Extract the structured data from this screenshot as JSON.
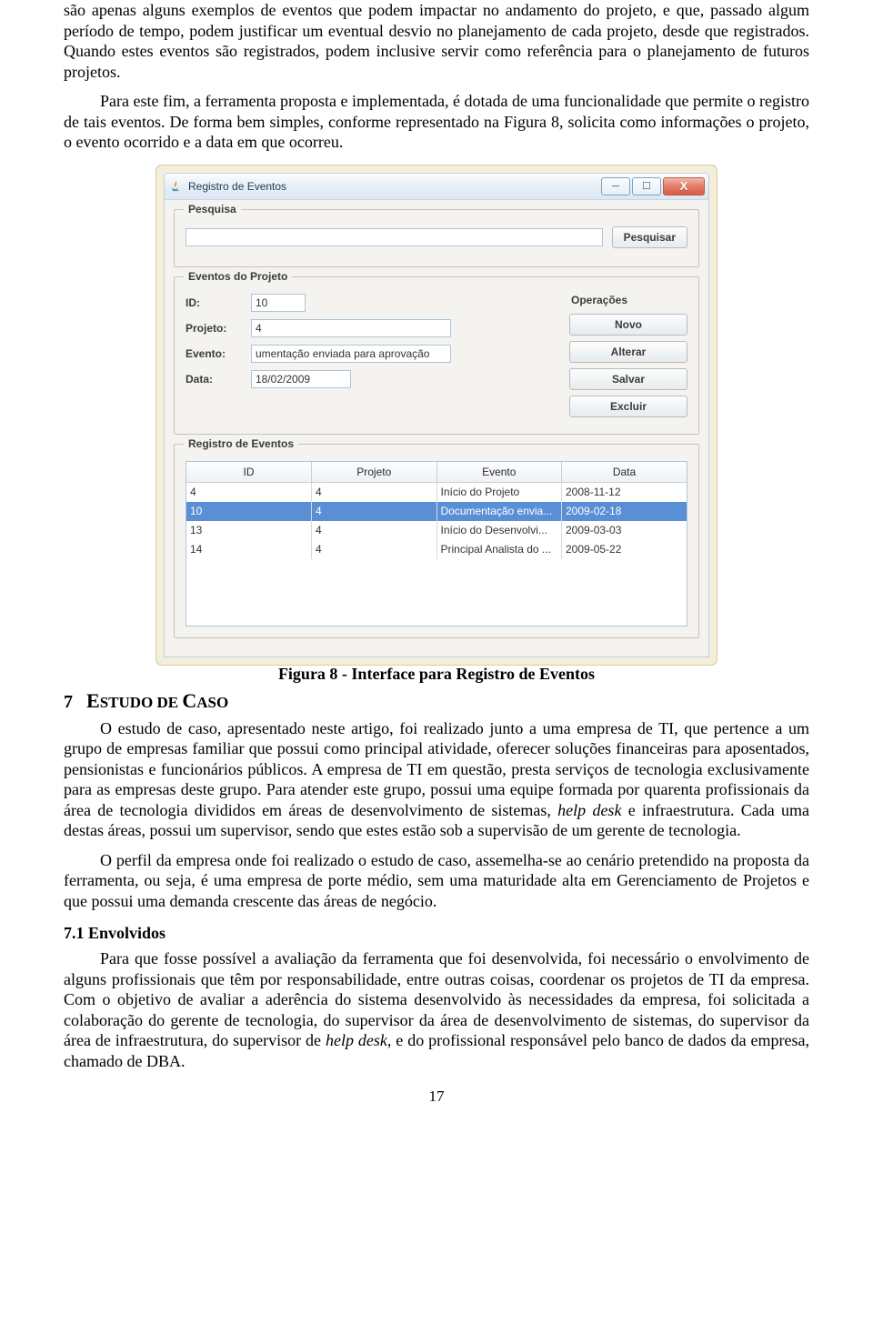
{
  "p1": "são apenas alguns exemplos de eventos que podem impactar no andamento do projeto, e que, passado algum período de tempo, podem justificar um eventual desvio no planejamento de cada projeto, desde que registrados. Quando estes eventos são registrados, podem inclusive servir como referência para o planejamento de futuros projetos.",
  "p2": "Para este fim, a ferramenta proposta e implementada, é dotada de uma funcionalidade que permite o registro de tais eventos. De forma bem simples, conforme representado na Figura 8, solicita como informações o projeto, o evento ocorrido e a data em que ocorreu.",
  "fig_caption": "Figura 8 - Interface para Registro de Eventos",
  "section7_number": "7",
  "section7_title_a": "E",
  "section7_title_b": "STUDO DE ",
  "section7_title_c": "C",
  "section7_title_d": "ASO",
  "p3a": "O estudo de caso, apresentado neste artigo, foi realizado junto a uma empresa de TI, que pertence a um grupo de empresas familiar que possui como principal atividade, oferecer soluções financeiras para aposentados, pensionistas e funcionários públicos. A empresa de TI em questão, presta serviços de tecnologia exclusivamente para as empresas deste grupo. Para atender este grupo, possui uma equipe formada por quarenta profissionais da área de tecnologia divididos em áreas de desenvolvimento de sistemas, ",
  "p3b": "help desk",
  "p3c": " e infraestrutura. Cada uma destas áreas, possui um supervisor, sendo que estes estão sob a supervisão de um gerente de tecnologia.",
  "p4": "O perfil da empresa onde foi realizado o estudo de caso, assemelha-se ao cenário pretendido na proposta da ferramenta, ou seja, é uma empresa de porte médio, sem uma maturidade alta em Gerenciamento de Projetos e que possui uma demanda crescente das áreas de negócio.",
  "sub71": "7.1 Envolvidos",
  "p5a": "Para que fosse possível a avaliação da ferramenta que foi desenvolvida, foi necessário o envolvimento de alguns profissionais que têm por responsabilidade, entre outras coisas, coordenar os projetos de TI da empresa. Com o objetivo de avaliar a aderência do sistema desenvolvido às necessidades da empresa, foi solicitada a colaboração do gerente de tecnologia, do supervisor da área de desenvolvimento de sistemas, do supervisor da área de infraestrutura, do supervisor de ",
  "p5b": "help desk",
  "p5c": ", e do profissional responsável pelo banco de dados da empresa, chamado de DBA.",
  "page_number": "17",
  "app": {
    "window_title": "Registro de Eventos",
    "group_pesquisa": "Pesquisa",
    "btn_pesquisar": "Pesquisar",
    "group_eventos": "Eventos do Projeto",
    "ops_header": "Operações",
    "btn_novo": "Novo",
    "btn_alterar": "Alterar",
    "btn_salvar": "Salvar",
    "btn_excluir": "Excluir",
    "lbl_id": "ID:",
    "lbl_projeto": "Projeto:",
    "lbl_evento": "Evento:",
    "lbl_data": "Data:",
    "val_id": "10",
    "val_projeto": "4",
    "val_evento": "umentação enviada para aprovação",
    "val_data": "18/02/2009",
    "group_registro": "Registro de Eventos",
    "table": {
      "headers": [
        "ID",
        "Projeto",
        "Evento",
        "Data"
      ],
      "rows": [
        {
          "id": "4",
          "projeto": "4",
          "evento": "Início do Projeto",
          "data": "2008-11-12",
          "selected": false
        },
        {
          "id": "10",
          "projeto": "4",
          "evento": "Documentação envia...",
          "data": "2009-02-18",
          "selected": true
        },
        {
          "id": "13",
          "projeto": "4",
          "evento": "Início do Desenvolvi...",
          "data": "2009-03-03",
          "selected": false
        },
        {
          "id": "14",
          "projeto": "4",
          "evento": "Principal Analista do ...",
          "data": "2009-05-22",
          "selected": false
        }
      ]
    }
  }
}
